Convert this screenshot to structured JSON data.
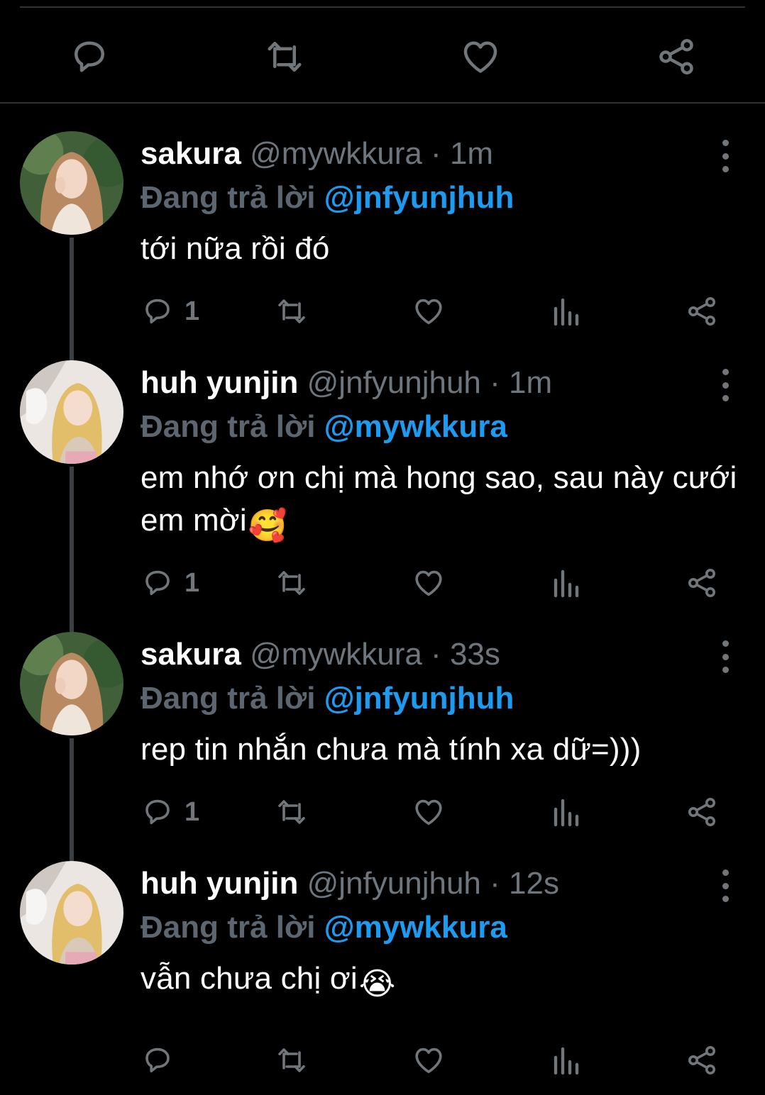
{
  "icons": {
    "reply": "reply-icon",
    "retweet": "retweet-icon",
    "like": "heart-icon",
    "share": "share-icon",
    "analytics": "analytics-icon",
    "more": "more-icon"
  },
  "colors": {
    "background": "#000000",
    "link": "#1d9bf0",
    "muted": "#6e767d",
    "divider": "#2f3336"
  },
  "replies": [
    {
      "name": "sakura",
      "handle": "@mywkkura",
      "separator": "·",
      "time": "1m",
      "replying_prefix": "Đang trả lời",
      "replying_to": "@jnfyunjhuh",
      "text": "tới nữa rồi đó",
      "emoji": "",
      "reply_count": "1"
    },
    {
      "name": "huh yunjin",
      "handle": "@jnfyunjhuh",
      "separator": "·",
      "time": "1m",
      "replying_prefix": "Đang trả lời",
      "replying_to": "@mywkkura",
      "text": "em nhớ ơn chị mà hong sao, sau này cưới em mời",
      "emoji": "🥰",
      "reply_count": "1"
    },
    {
      "name": "sakura",
      "handle": "@mywkkura",
      "separator": "·",
      "time": "33s",
      "replying_prefix": "Đang trả lời",
      "replying_to": "@jnfyunjhuh",
      "text": "rep tin nhắn chưa mà tính xa dữ=)))",
      "emoji": "",
      "reply_count": "1"
    },
    {
      "name": "huh yunjin",
      "handle": "@jnfyunjhuh",
      "separator": "·",
      "time": "12s",
      "replying_prefix": "Đang trả lời",
      "replying_to": "@mywkkura",
      "text": "vẫn chưa chị ơi",
      "emoji": "😭",
      "reply_count": ""
    }
  ]
}
